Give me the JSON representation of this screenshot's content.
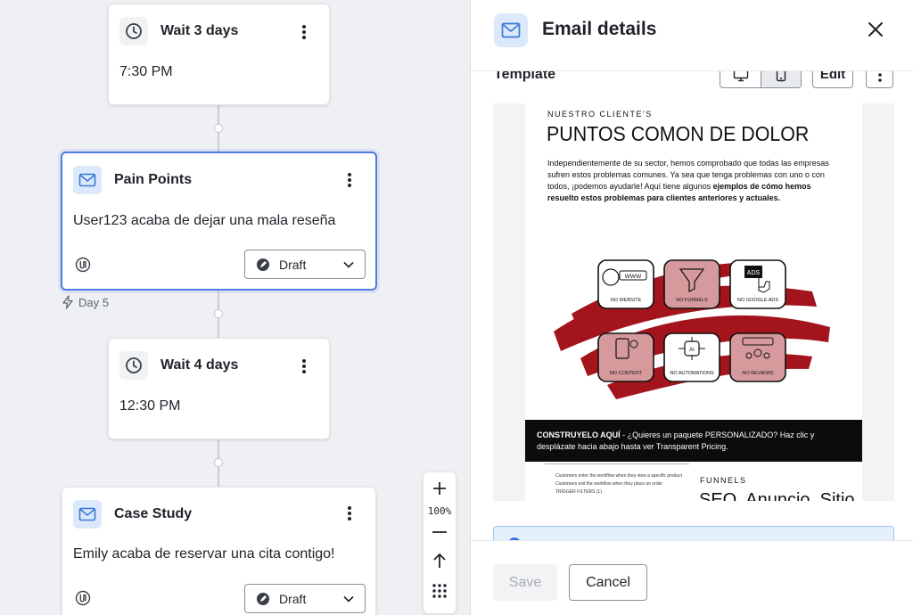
{
  "canvas": {
    "nodes": [
      {
        "type": "wait",
        "title": "Wait 3 days",
        "time": "7:30 PM"
      },
      {
        "type": "email",
        "title": "Pain Points",
        "body": "User123 acaba de dejar una mala reseña",
        "status": "Draft",
        "selected": true
      },
      {
        "type": "wait",
        "title": "Wait 4 days",
        "time": "12:30 PM"
      },
      {
        "type": "email",
        "title": "Case Study",
        "body": "Emily acaba de reservar una cita contigo!",
        "status": "Draft"
      }
    ],
    "day_tag": "Day 5",
    "zoom": {
      "level": "100%"
    }
  },
  "panel": {
    "title": "Email details",
    "template_label": "Template",
    "edit_label": "Edit",
    "preview": {
      "eyebrow": "NUESTRO CLIENTE'S",
      "headline": "PUNTOS COMON DE DOLOR",
      "para_normal": "Independientemente de su sector, hemos comprobado que todas las empresas sufren estos problemas comunes. Ya sea que tenga problemas con uno o con todos, ¡podemos ayudarle! Aquí tiene algunos ",
      "para_bold": "ejemplos de cómo hemos resuelto estos problemas para clientes anteriores y actuales.",
      "tiles": [
        "NO WEBSITE",
        "NO FUNNELS",
        "NO GOOGLE ADS",
        "NO CONTENT",
        "NO AUTOMATIONS",
        "NO REVIEWS"
      ],
      "tile_glyphs": [
        "WWW",
        "ADS",
        "AI"
      ],
      "bar_bold": "CONSTRUYELO AQUÍ",
      "bar_text": " - ¿Quieres un paquete PERSONALIZADO? Haz clic y desplázate hacia abajo hasta ver Transparent Pricing.",
      "mini_lines": [
        "Customers enter the workflow when they view a specific product",
        "Customers exit the workflow when they place an order",
        "TRIGGER FILTERS (1)"
      ],
      "funnels_label": "FUNNELS",
      "funnels_heading": "SEO, Anuncio, Sitio"
    },
    "footer": {
      "save_label": "Save",
      "cancel_label": "Cancel"
    }
  },
  "colors": {
    "accent": "#4f7be0",
    "brand_red": "#a3141c",
    "tile_pink": "#d79a9c"
  }
}
